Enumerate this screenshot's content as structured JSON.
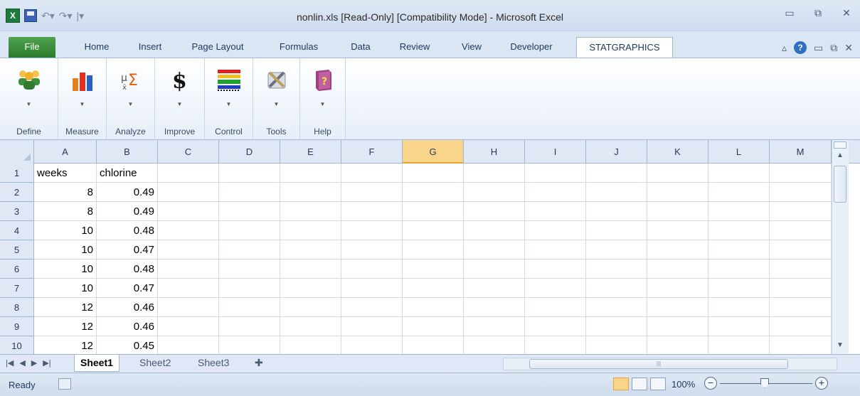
{
  "window": {
    "title": "nonlin.xls  [Read-Only]  [Compatibility Mode]  -  Microsoft Excel",
    "app_icon": "excel-icon",
    "controls": [
      "minimize",
      "restore",
      "close"
    ]
  },
  "tabs": [
    {
      "label": "File"
    },
    {
      "label": "Home"
    },
    {
      "label": "Insert"
    },
    {
      "label": "Page Layout"
    },
    {
      "label": "Formulas"
    },
    {
      "label": "Data"
    },
    {
      "label": "Review"
    },
    {
      "label": "View"
    },
    {
      "label": "Developer"
    },
    {
      "label": "STATGRAPHICS",
      "active": true
    }
  ],
  "ribbon_groups": [
    {
      "label": "Define",
      "icon": "people-icon"
    },
    {
      "label": "Measure",
      "icon": "bar-chart-icon"
    },
    {
      "label": "Analyze",
      "icon": "sigma-icon"
    },
    {
      "label": "Improve",
      "icon": "dollar-icon"
    },
    {
      "label": "Control",
      "icon": "control-chart-icon"
    },
    {
      "label": "Tools",
      "icon": "tools-icon"
    },
    {
      "label": "Help",
      "icon": "help-book-icon"
    }
  ],
  "columns": [
    "A",
    "B",
    "C",
    "D",
    "E",
    "F",
    "G",
    "H",
    "I",
    "J",
    "K",
    "L",
    "M"
  ],
  "selected_column": "G",
  "rows": [
    {
      "n": "1",
      "a": "weeks",
      "b": "chlorine"
    },
    {
      "n": "2",
      "a": "8",
      "b": "0.49"
    },
    {
      "n": "3",
      "a": "8",
      "b": "0.49"
    },
    {
      "n": "4",
      "a": "10",
      "b": "0.48"
    },
    {
      "n": "5",
      "a": "10",
      "b": "0.47"
    },
    {
      "n": "6",
      "a": "10",
      "b": "0.48"
    },
    {
      "n": "7",
      "a": "10",
      "b": "0.47"
    },
    {
      "n": "8",
      "a": "12",
      "b": "0.46"
    },
    {
      "n": "9",
      "a": "12",
      "b": "0.46"
    },
    {
      "n": "10",
      "a": "12",
      "b": "0.45"
    }
  ],
  "sheets": [
    {
      "label": "Sheet1",
      "active": true
    },
    {
      "label": "Sheet2"
    },
    {
      "label": "Sheet3"
    }
  ],
  "status": {
    "text": "Ready",
    "zoom": "100%"
  },
  "colors": {
    "file_tab": "#2b7b2b",
    "selected_header": "#f9d58b",
    "header_bg": "#dfe8f4"
  }
}
